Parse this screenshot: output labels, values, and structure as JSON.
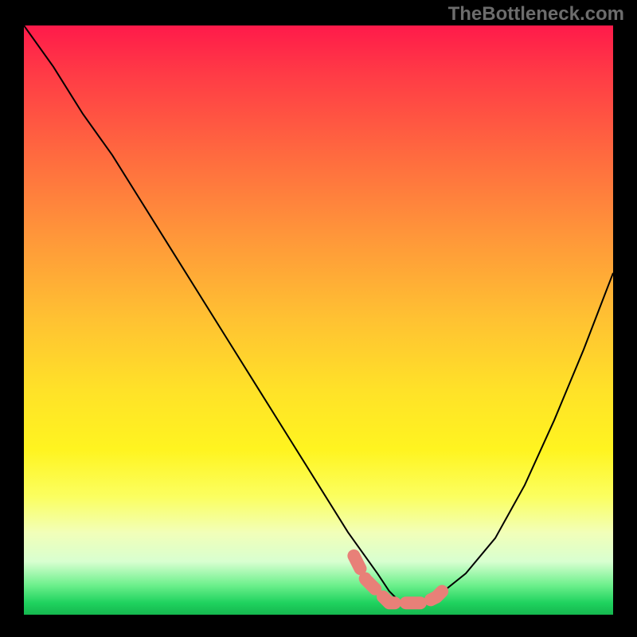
{
  "watermark": "TheBottleneck.com",
  "chart_data": {
    "type": "line",
    "title": "",
    "xlabel": "",
    "ylabel": "",
    "xlim": [
      0,
      100
    ],
    "ylim": [
      0,
      100
    ],
    "series": [
      {
        "name": "curve",
        "x": [
          0,
          5,
          10,
          15,
          20,
          25,
          30,
          35,
          40,
          45,
          50,
          55,
          60,
          62,
          64,
          66,
          68,
          70,
          75,
          80,
          85,
          90,
          95,
          100
        ],
        "y": [
          100,
          93,
          85,
          78,
          70,
          62,
          54,
          46,
          38,
          30,
          22,
          14,
          7,
          4,
          2,
          2,
          2,
          3,
          7,
          13,
          22,
          33,
          45,
          58
        ]
      }
    ],
    "highlight_region": {
      "name": "bottom-segment",
      "color": "#e88078",
      "x": [
        56,
        58,
        60,
        62,
        64,
        66,
        68,
        70,
        72
      ],
      "y": [
        10,
        6,
        4,
        2,
        2,
        2,
        2,
        3,
        5
      ]
    },
    "colors": {
      "curve": "#000000",
      "highlight": "#e88078",
      "background_top": "#ff1a4a",
      "background_bottom": "#15b74f",
      "frame": "#000000"
    }
  }
}
